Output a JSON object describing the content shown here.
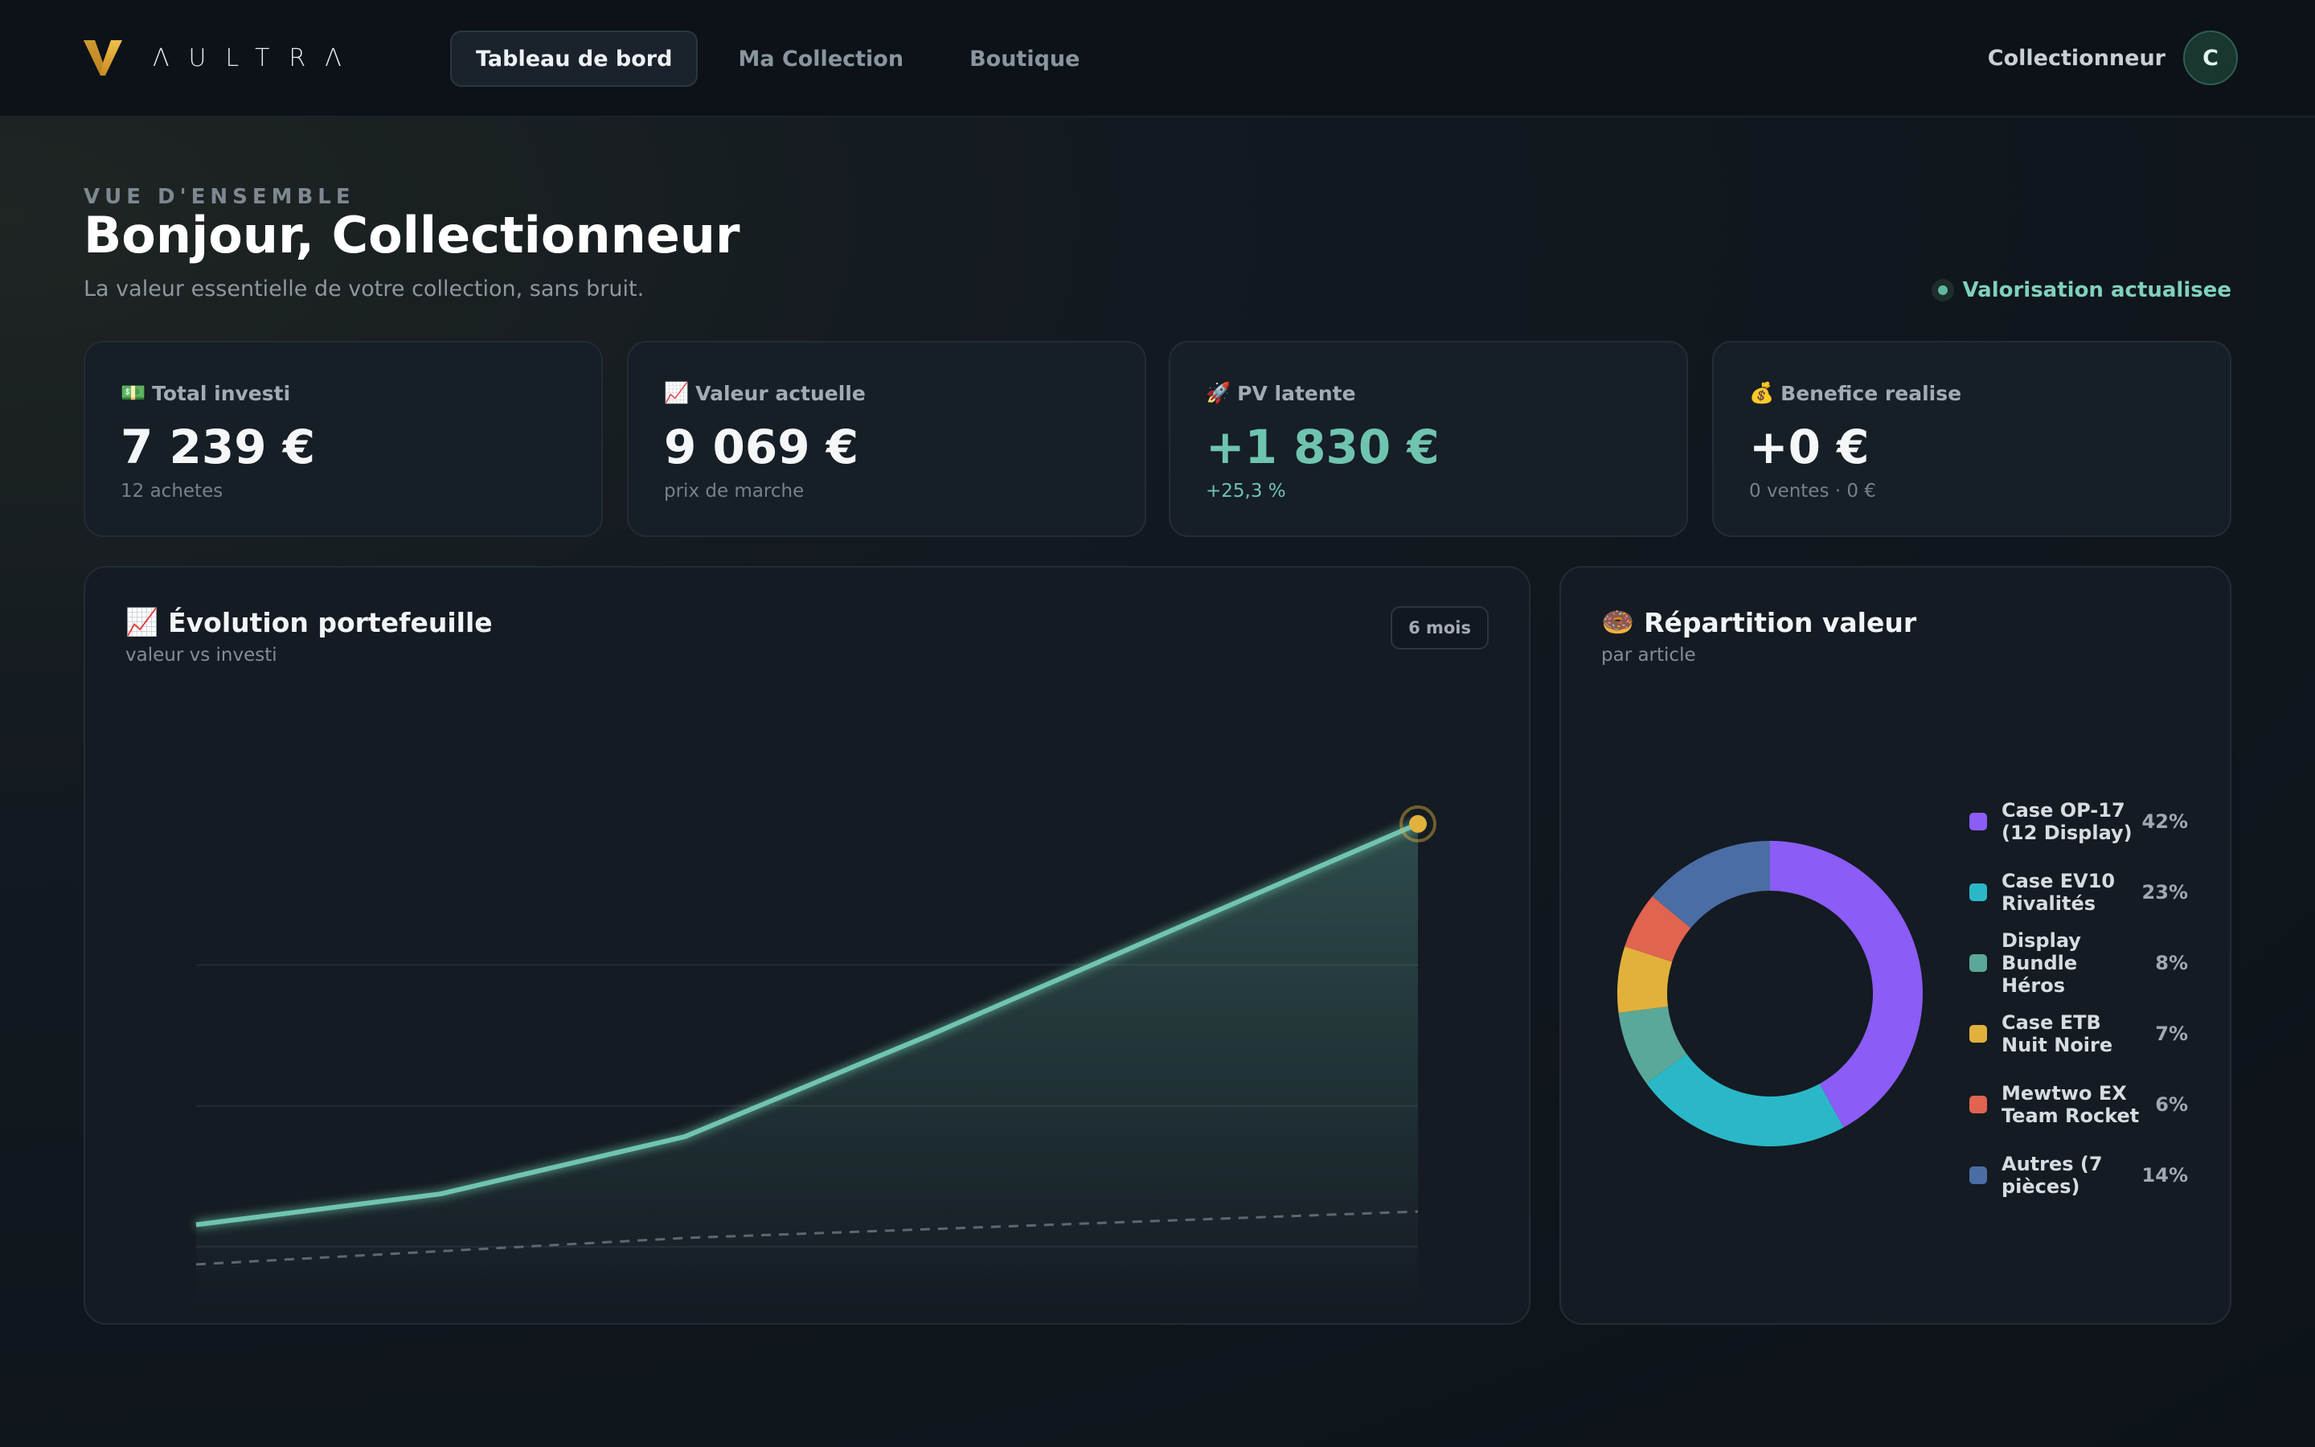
{
  "app": {
    "brand": "ΛULTRΛ",
    "brand_colors": {
      "mark": "#e0a93a"
    }
  },
  "nav": {
    "tabs": [
      {
        "label": "Tableau de bord",
        "active": true
      },
      {
        "label": "Ma Collection",
        "active": false
      },
      {
        "label": "Boutique",
        "active": false
      }
    ]
  },
  "user": {
    "name": "Collectionneur",
    "initial": "C"
  },
  "header": {
    "eyebrow": "VUE D'ENSEMBLE",
    "title": "Bonjour, Collectionneur",
    "subtitle": "La valeur essentielle de votre collection, sans bruit.",
    "status": "Valorisation actualisee"
  },
  "kpis": [
    {
      "icon": "💵",
      "icon_name": "money-bill-icon",
      "label": "Total investi",
      "value": "7 239 €",
      "sub": "12 achetes"
    },
    {
      "icon": "📈",
      "icon_name": "chart-up-icon",
      "label": "Valeur actuelle",
      "value": "9 069 €",
      "sub": "prix de marche"
    },
    {
      "icon": "🚀",
      "icon_name": "rocket-icon",
      "label": "PV latente",
      "value": "+1 830 €",
      "sub": "+25,3 %"
    },
    {
      "icon": "💰",
      "icon_name": "money-bag-icon",
      "label": "Benefice realise",
      "value": "+0 €",
      "sub": "0 ventes · 0 €"
    }
  ],
  "colors": {
    "accent": "#6fc4b0",
    "highlight": "#e0b23c"
  },
  "evolution": {
    "icon": "📈",
    "title": "Évolution portefeuille",
    "subtitle": "valeur vs investi",
    "range_label": "6 mois"
  },
  "repartition": {
    "icon": "🍩",
    "title": "Répartition valeur",
    "subtitle": "par article"
  },
  "chart_data": [
    {
      "type": "line",
      "x": [
        1,
        2,
        3,
        4,
        5,
        6
      ],
      "series": [
        {
          "values": [
            5900,
            6250,
            6900,
            8050,
            9250,
            10450
          ],
          "style": "solid",
          "color": "#6fc4b0"
        },
        {
          "values": [
            5450,
            5600,
            5750,
            5850,
            5950,
            6050
          ],
          "style": "dashed",
          "color": "#5d6770"
        }
      ],
      "ylim": [
        4600,
        11900
      ],
      "grid": true,
      "legend": "none"
    },
    {
      "type": "pie",
      "donut": true,
      "slices": [
        {
          "label": "Case OP-17 (12 Display)",
          "value": 42,
          "pct_label": "42%",
          "color": "#8b5cf6"
        },
        {
          "label": "Case EV10 Rivalités",
          "value": 23,
          "pct_label": "23%",
          "color": "#2ab8c8"
        },
        {
          "label": "Display Bundle Héros",
          "value": 8,
          "pct_label": "8%",
          "color": "#5aa897"
        },
        {
          "label": "Case ETB Nuit Noire",
          "value": 7,
          "pct_label": "7%",
          "color": "#e2b13c"
        },
        {
          "label": "Mewtwo EX Team Rocket",
          "value": 6,
          "pct_label": "6%",
          "color": "#e06450"
        },
        {
          "label": "Autres (7 pièces)",
          "value": 14,
          "pct_label": "14%",
          "color": "#4a6da6"
        }
      ],
      "legend": "right"
    }
  ]
}
